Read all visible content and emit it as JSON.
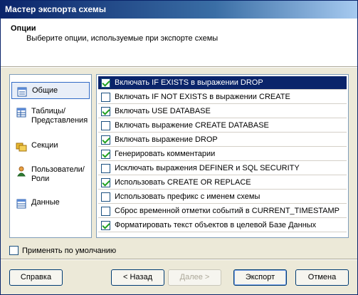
{
  "window": {
    "title": "Мастер экспорта схемы"
  },
  "header": {
    "title": "Опции",
    "subtitle": "Выберите опции, используемые при экспорте схемы"
  },
  "nav": {
    "items": [
      {
        "label": "Общие",
        "icon": "general-options-icon",
        "selected": true
      },
      {
        "label": "Таблицы/ Представления",
        "icon": "tables-icon",
        "selected": false
      },
      {
        "label": "Секции",
        "icon": "sections-icon",
        "selected": false
      },
      {
        "label": "Пользователи/ Роли",
        "icon": "users-icon",
        "selected": false
      },
      {
        "label": "Данные",
        "icon": "data-icon",
        "selected": false
      }
    ]
  },
  "options": [
    {
      "label": "Включать IF EXISTS в выражении DROP",
      "checked": true,
      "selected": true
    },
    {
      "label": "Включать IF NOT EXISTS в выражении CREATE",
      "checked": false,
      "selected": false
    },
    {
      "label": "Включать USE DATABASE",
      "checked": true,
      "selected": false
    },
    {
      "label": "Включать выражение CREATE DATABASE",
      "checked": false,
      "selected": false
    },
    {
      "label": "Включать выражение DROP",
      "checked": true,
      "selected": false
    },
    {
      "label": "Генерировать комментарии",
      "checked": true,
      "selected": false
    },
    {
      "label": "Исключать выражения DEFINER и SQL SECURITY",
      "checked": false,
      "selected": false
    },
    {
      "label": "Использовать CREATE OR REPLACE",
      "checked": true,
      "selected": false
    },
    {
      "label": "Использовать префикс с именем схемы",
      "checked": false,
      "selected": false
    },
    {
      "label": "Сброс временной отметки событий в CURRENT_TIMESTAMP",
      "checked": false,
      "selected": false
    },
    {
      "label": "Форматировать текст объектов в целевой Базе Данных",
      "checked": true,
      "selected": false
    }
  ],
  "default_option": {
    "label": "Применять по умолчанию",
    "checked": false
  },
  "buttons": {
    "help": "Справка",
    "back": "< Назад",
    "next": "Далее >",
    "export": "Экспорт",
    "cancel": "Отмена"
  }
}
